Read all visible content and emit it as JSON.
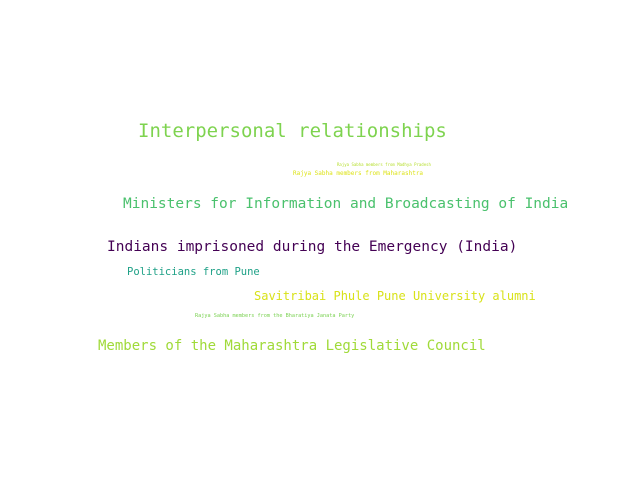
{
  "word_cloud": {
    "words": [
      {
        "text": "Interpersonal relationships",
        "color": "#7ed34f"
      },
      {
        "text": "Rajya Sabha members from Madhya Pradesh",
        "color": "#b5de2b"
      },
      {
        "text": "Rajya Sabha members from Maharashtra",
        "color": "#dde318"
      },
      {
        "text": "Ministers for Information and Broadcasting of India",
        "color": "#4ac16d"
      },
      {
        "text": "Indians imprisoned during the Emergency (India)",
        "color": "#440154"
      },
      {
        "text": "Politicians from Pune",
        "color": "#1fa187"
      },
      {
        "text": "Savitribai Phule Pune University alumni",
        "color": "#d8e219"
      },
      {
        "text": "Rajya Sabha members from the Bharatiya Janata Party",
        "color": "#7ad151"
      },
      {
        "text": "Members of the Maharashtra Legislative Council",
        "color": "#a0da39"
      }
    ]
  }
}
